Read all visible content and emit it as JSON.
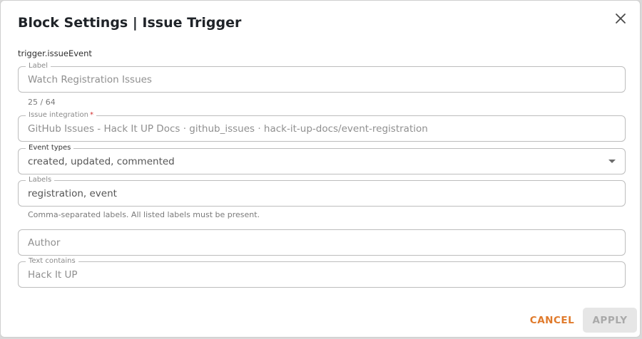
{
  "dialog": {
    "title": "Block Settings | Issue Trigger",
    "block_key": "trigger.issueEvent"
  },
  "fields": {
    "label": {
      "legend": "Label",
      "value": "Watch Registration Issues",
      "counter": "25 / 64"
    },
    "integration": {
      "legend": "Issue integration",
      "required_mark": "*",
      "value": "GitHub Issues - Hack It UP Docs · github_issues · hack-it-up-docs/event-registration"
    },
    "event_types": {
      "legend": "Event types",
      "value": "created, updated, commented"
    },
    "labels": {
      "legend": "Labels",
      "value": "registration, event",
      "helper": "Comma-separated labels. All listed labels must be present."
    },
    "author": {
      "placeholder": "Author"
    },
    "text_contains": {
      "legend": "Text contains",
      "value": "Hack It UP"
    }
  },
  "actions": {
    "cancel_label": "CANCEL",
    "apply_label": "APPLY"
  },
  "icons": {
    "close": "close-icon",
    "dropdown": "chevron-down-icon"
  },
  "colors": {
    "accent": "#e07a2b",
    "disabled_bg": "#e6e6e6",
    "disabled_text": "#a9a9a9",
    "required": "#d32f2f"
  }
}
